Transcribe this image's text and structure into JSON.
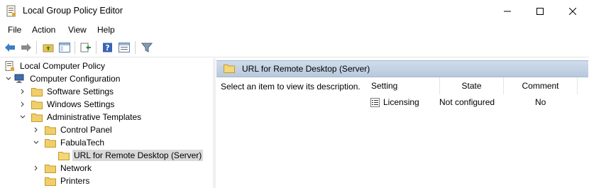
{
  "window": {
    "title": "Local Group Policy Editor",
    "icon": "policy-editor-icon"
  },
  "menu": {
    "items": [
      "File",
      "Action",
      "View",
      "Help"
    ]
  },
  "toolbar": {
    "buttons": [
      "back-icon",
      "forward-icon",
      "up-folder-icon",
      "show-hide-tree-icon",
      "export-list-icon",
      "help-icon",
      "properties-icon",
      "filter-icon"
    ]
  },
  "tree": {
    "root": "Local Computer Policy",
    "items": [
      {
        "label": "Computer Configuration",
        "expanded": true
      },
      {
        "label": "Software Settings",
        "expanded": false
      },
      {
        "label": "Windows Settings",
        "expanded": false
      },
      {
        "label": "Administrative Templates",
        "expanded": true
      },
      {
        "label": "Control Panel",
        "expanded": false
      },
      {
        "label": "FabulaTech",
        "expanded": true
      },
      {
        "label": "URL for Remote Desktop (Server)",
        "selected": true
      },
      {
        "label": "Network",
        "expanded": false
      },
      {
        "label": "Printers",
        "expanded": false
      }
    ]
  },
  "main": {
    "header_title": "URL for Remote Desktop (Server)",
    "description": "Select an item to view its description.",
    "columns": [
      "Setting",
      "State",
      "Comment"
    ],
    "rows": [
      {
        "setting": "Licensing",
        "state": "Not configured",
        "comment": "No"
      }
    ]
  },
  "colors": {
    "header_bar": "#c2d1e3",
    "selection": "#d9d9d9",
    "folder": "#e8c25a"
  }
}
